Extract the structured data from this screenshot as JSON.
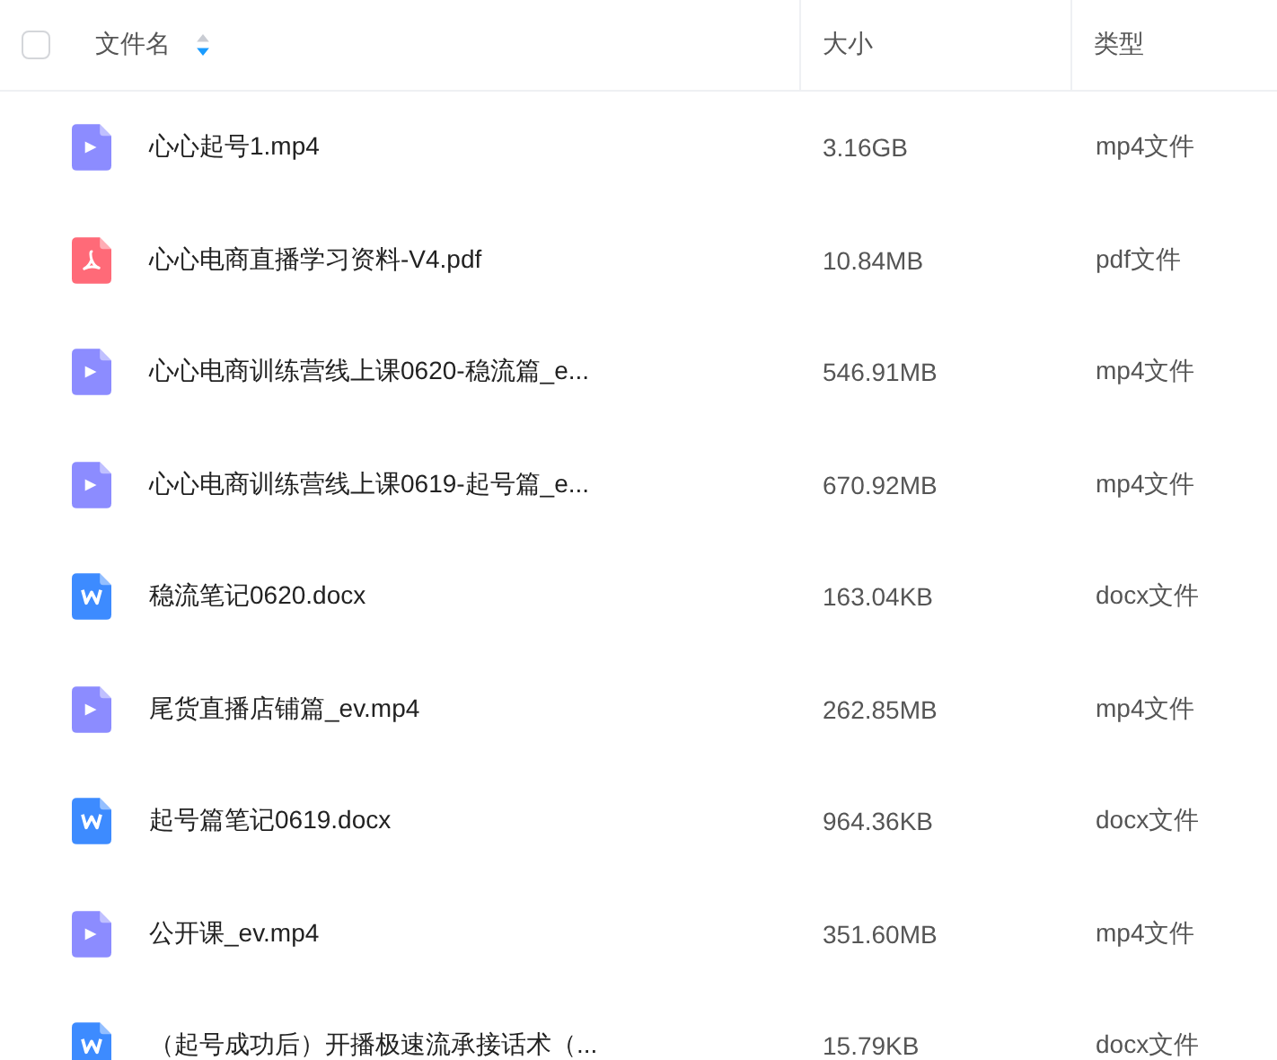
{
  "header": {
    "checkbox": {
      "checked": false
    },
    "columns": [
      {
        "label": "文件名",
        "sorted_descending": true
      },
      {
        "label": "大小"
      },
      {
        "label": "类型"
      }
    ]
  },
  "rows": [
    {
      "kind": "video",
      "name": "心心起号1.mp4",
      "size": "3.16GB",
      "type": "mp4文件"
    },
    {
      "kind": "pdf",
      "name": "心心电商直播学习资料-V4.pdf",
      "size": "10.84MB",
      "type": "pdf文件"
    },
    {
      "kind": "video",
      "name": "心心电商训练营线上课0620-稳流篇_e...",
      "size": "546.91MB",
      "type": "mp4文件"
    },
    {
      "kind": "video",
      "name": "心心电商训练营线上课0619-起号篇_e...",
      "size": "670.92MB",
      "type": "mp4文件"
    },
    {
      "kind": "word",
      "name": "稳流笔记0620.docx",
      "size": "163.04KB",
      "type": "docx文件"
    },
    {
      "kind": "video",
      "name": "尾货直播店铺篇_ev.mp4",
      "size": "262.85MB",
      "type": "mp4文件"
    },
    {
      "kind": "word",
      "name": "起号篇笔记0619.docx",
      "size": "964.36KB",
      "type": "docx文件"
    },
    {
      "kind": "video",
      "name": "公开课_ev.mp4",
      "size": "351.60MB",
      "type": "mp4文件"
    },
    {
      "kind": "word",
      "name": "（起号成功后）开播极速流承接话术（...",
      "size": "15.79KB",
      "type": "docx文件"
    }
  ]
}
